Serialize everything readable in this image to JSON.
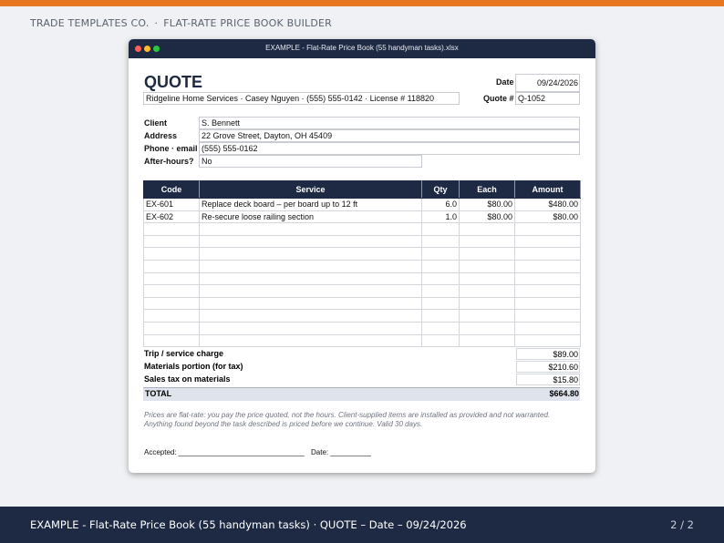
{
  "brand": {
    "company": "TRADE TEMPLATES CO.",
    "separator": "·",
    "product": "FLAT-RATE PRICE BOOK BUILDER"
  },
  "window": {
    "title": "EXAMPLE - Flat-Rate Price Book (55 handyman tasks).xlsx"
  },
  "quote": {
    "title": "QUOTE",
    "business_line": "Ridgeline Home Services  ·  Casey Nguyen · (555) 555-0142  ·  License # 118820",
    "date_label": "Date",
    "date_value": "09/24/2026",
    "quote_num_label": "Quote #",
    "quote_num_value": "Q-1052"
  },
  "client": {
    "client_label": "Client",
    "client_value": "S. Bennett",
    "address_label": "Address",
    "address_value": "22 Grove Street, Dayton, OH 45409",
    "phone_label": "Phone · email",
    "phone_value": "(555) 555-0162",
    "after_hours_label": "After-hours?",
    "after_hours_value": "No"
  },
  "table": {
    "headers": [
      "Code",
      "Service",
      "Qty",
      "Each",
      "Amount"
    ],
    "rows": [
      [
        "EX-601",
        "Replace deck board – per board up to 12 ft",
        "6.0",
        "$80.00",
        "$480.00"
      ],
      [
        "EX-602",
        "Re-secure loose railing section",
        "1.0",
        "$80.00",
        "$80.00"
      ],
      [
        "",
        "",
        "",
        "",
        ""
      ],
      [
        "",
        "",
        "",
        "",
        ""
      ],
      [
        "",
        "",
        "",
        "",
        ""
      ],
      [
        "",
        "",
        "",
        "",
        ""
      ],
      [
        "",
        "",
        "",
        "",
        ""
      ],
      [
        "",
        "",
        "",
        "",
        ""
      ],
      [
        "",
        "",
        "",
        "",
        ""
      ],
      [
        "",
        "",
        "",
        "",
        ""
      ],
      [
        "",
        "",
        "",
        "",
        ""
      ],
      [
        "",
        "",
        "",
        "",
        ""
      ]
    ]
  },
  "totals": {
    "trip_label": "Trip / service charge",
    "trip_value": "$89.00",
    "materials_label": "Materials portion (for tax)",
    "materials_value": "$210.60",
    "tax_label": "Sales tax on materials",
    "tax_value": "$15.80",
    "total_label": "TOTAL",
    "total_value": "$664.80"
  },
  "note": "Prices are flat-rate: you pay the price quoted, not the hours. Client-supplied items are installed as provided and not warranted. Anything found beyond the task described is priced before we continue. Valid 30 days.",
  "accept": {
    "accepted": "Accepted: _______________________________",
    "date": "Date: __________"
  },
  "footer": {
    "text": "EXAMPLE - Flat-Rate Price Book (55 handyman tasks) · QUOTE – Date – 09/24/2026",
    "page": "2 / 2"
  },
  "colors": {
    "accent": "#e87722",
    "navy": "#1e2a44",
    "total_fill": "#dfe3ec"
  }
}
